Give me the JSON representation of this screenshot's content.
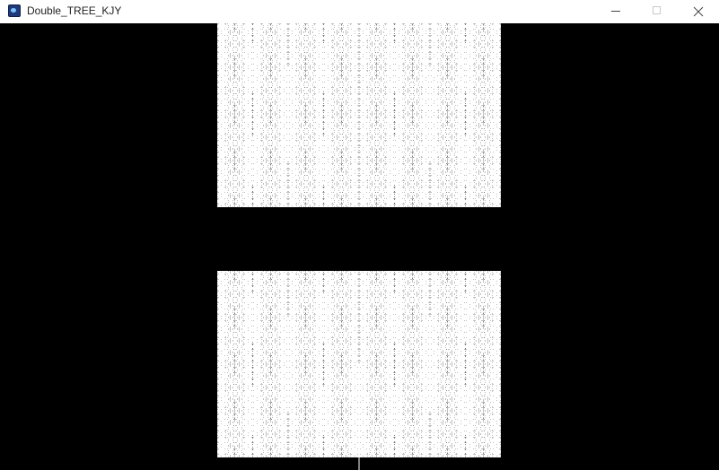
{
  "window": {
    "title": "Double_TREE_KJY",
    "icon": "app-icon",
    "controls": {
      "minimize_icon": "minimize-icon",
      "maximize_icon": "maximize-icon",
      "close_icon": "close-icon"
    }
  },
  "canvas": {
    "background": "#000000",
    "stroke_color": "#ffffff",
    "fractal": "h-tree",
    "tree_count": 2,
    "levels": 9
  }
}
